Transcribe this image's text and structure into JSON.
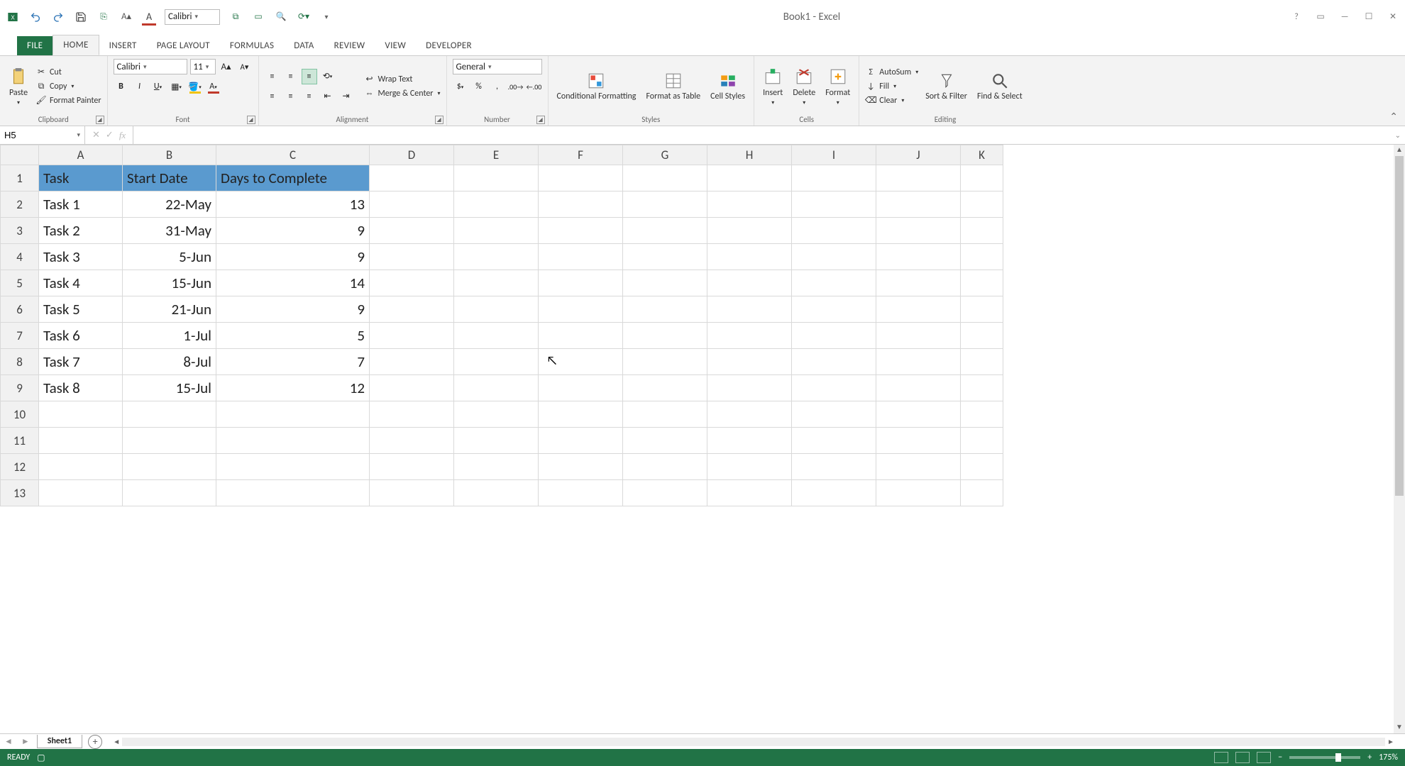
{
  "title": "Book1 - Excel",
  "qat_font": "Calibri",
  "tabs": {
    "file": "FILE",
    "home": "HOME",
    "insert": "INSERT",
    "pagelayout": "PAGE LAYOUT",
    "formulas": "FORMULAS",
    "data": "DATA",
    "review": "REVIEW",
    "view": "VIEW",
    "developer": "DEVELOPER"
  },
  "ribbon": {
    "clipboard": {
      "label": "Clipboard",
      "paste": "Paste",
      "cut": "Cut",
      "copy": "Copy",
      "format_painter": "Format Painter"
    },
    "font": {
      "label": "Font",
      "name": "Calibri",
      "size": "11"
    },
    "alignment": {
      "label": "Alignment",
      "wrap": "Wrap Text",
      "merge": "Merge & Center"
    },
    "number": {
      "label": "Number",
      "format": "General"
    },
    "styles": {
      "label": "Styles",
      "cond": "Conditional Formatting",
      "table": "Format as Table",
      "cell": "Cell Styles"
    },
    "cells": {
      "label": "Cells",
      "insert": "Insert",
      "delete": "Delete",
      "format": "Format"
    },
    "editing": {
      "label": "Editing",
      "autosum": "AutoSum",
      "fill": "Fill",
      "clear": "Clear",
      "sort": "Sort & Filter",
      "find": "Find & Select"
    }
  },
  "name_box": "H5",
  "formula_bar": "",
  "columns": [
    "A",
    "B",
    "C",
    "D",
    "E",
    "F",
    "G",
    "H",
    "I",
    "J",
    "K"
  ],
  "rows_shown": 13,
  "headers": {
    "A": "Task",
    "B": "Start Date",
    "C": "Days to Complete"
  },
  "data_rows": [
    {
      "task": "Task 1",
      "start": "22-May",
      "days": "13"
    },
    {
      "task": "Task 2",
      "start": "31-May",
      "days": "9"
    },
    {
      "task": "Task 3",
      "start": "5-Jun",
      "days": "9"
    },
    {
      "task": "Task 4",
      "start": "15-Jun",
      "days": "14"
    },
    {
      "task": "Task 5",
      "start": "21-Jun",
      "days": "9"
    },
    {
      "task": "Task 6",
      "start": "1-Jul",
      "days": "5"
    },
    {
      "task": "Task 7",
      "start": "8-Jul",
      "days": "7"
    },
    {
      "task": "Task 8",
      "start": "15-Jul",
      "days": "12"
    }
  ],
  "sheet_tab": "Sheet1",
  "status": {
    "ready": "READY",
    "zoom": "175%"
  }
}
